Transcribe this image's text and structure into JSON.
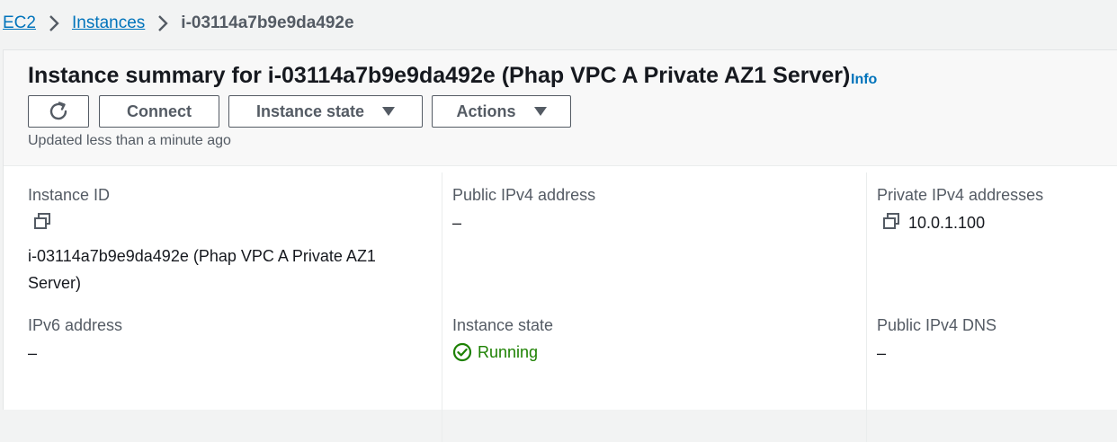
{
  "breadcrumb": {
    "items": [
      {
        "label": "EC2"
      },
      {
        "label": "Instances"
      }
    ],
    "current": "i-03114a7b9e9da492e"
  },
  "header": {
    "title": "Instance summary for i-03114a7b9e9da492e (Phap VPC A Private AZ1 Server)",
    "info_label": "Info",
    "updated_text": "Updated less than a minute ago"
  },
  "toolbar": {
    "connect_label": "Connect",
    "instance_state_label": "Instance state",
    "actions_label": "Actions"
  },
  "details": {
    "instance_id": {
      "label": "Instance ID",
      "value_line1": "i-03114a7b9e9da492e (Phap VPC A Private AZ1",
      "value_line2": "Server)"
    },
    "public_ipv4": {
      "label": "Public IPv4 address",
      "value": "–"
    },
    "private_ipv4": {
      "label": "Private IPv4 addresses",
      "value": "10.0.1.100"
    },
    "ipv6": {
      "label": "IPv6 address",
      "value": "–"
    },
    "instance_state": {
      "label": "Instance state",
      "value": "Running"
    },
    "public_dns": {
      "label": "Public IPv4 DNS",
      "value": "–"
    }
  },
  "colors": {
    "link": "#0073bb",
    "running": "#1d8102",
    "button_border": "#545b64"
  },
  "icons": [
    "chevron-right-icon",
    "refresh-icon",
    "caret-down-icon",
    "copy-icon",
    "check-circle-icon"
  ]
}
